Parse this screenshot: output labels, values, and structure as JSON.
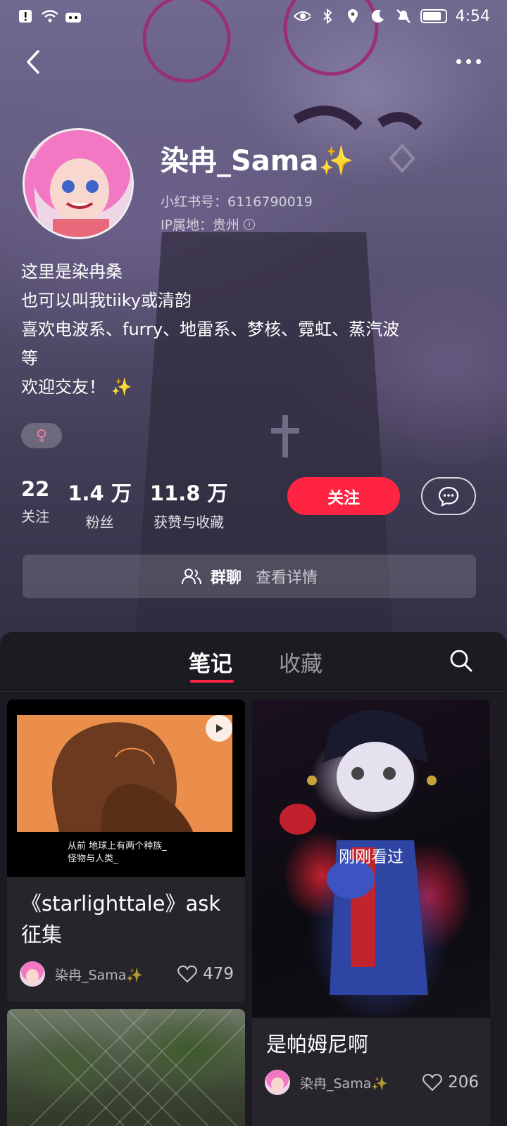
{
  "status_bar": {
    "time": "4:54",
    "left_icons": [
      "alert-icon",
      "wifi-icon",
      "app-icon"
    ],
    "right_icons": [
      "eye-icon",
      "bluetooth-icon",
      "location-icon",
      "moon-icon",
      "mute-icon",
      "battery-icon"
    ]
  },
  "profile": {
    "username": "染冉_Sama✨",
    "id_label": "小红书号：6116790019",
    "ip_label": "IP属地：贵州",
    "bio_lines": [
      "这里是染冉桑",
      "也可以叫我tiiky或清韵",
      "喜欢电波系、furry、地雷系、梦核、霓虹、蒸汽波",
      "等",
      "欢迎交友！ ✨"
    ],
    "gender_symbol": "♀",
    "stats": [
      {
        "value": "22",
        "label": "关注"
      },
      {
        "value": "1.4 万",
        "label": "粉丝"
      },
      {
        "value": "11.8 万",
        "label": "获赞与收藏"
      }
    ],
    "follow_label": "关注",
    "group_chat": {
      "label": "群聊",
      "detail": "查看详情"
    }
  },
  "tabs": [
    {
      "label": "笔记",
      "active": true
    },
    {
      "label": "收藏",
      "active": false
    }
  ],
  "notes": [
    {
      "title": "《starlighttale》ask 征集",
      "cover_caption_lines": [
        "从前  地球上有两个种族_",
        "怪物与人类_"
      ],
      "author": "染冉_Sama✨",
      "likes": "479",
      "is_video": true
    },
    {
      "title": "是帕姆尼啊",
      "overlay_label": "刚刚看过",
      "author": "染冉_Sama✨",
      "likes": "206",
      "is_video": false
    }
  ],
  "colors": {
    "accent": "#ff2442",
    "sheet_bg": "#1c1b21",
    "card_bg": "#26252c"
  }
}
